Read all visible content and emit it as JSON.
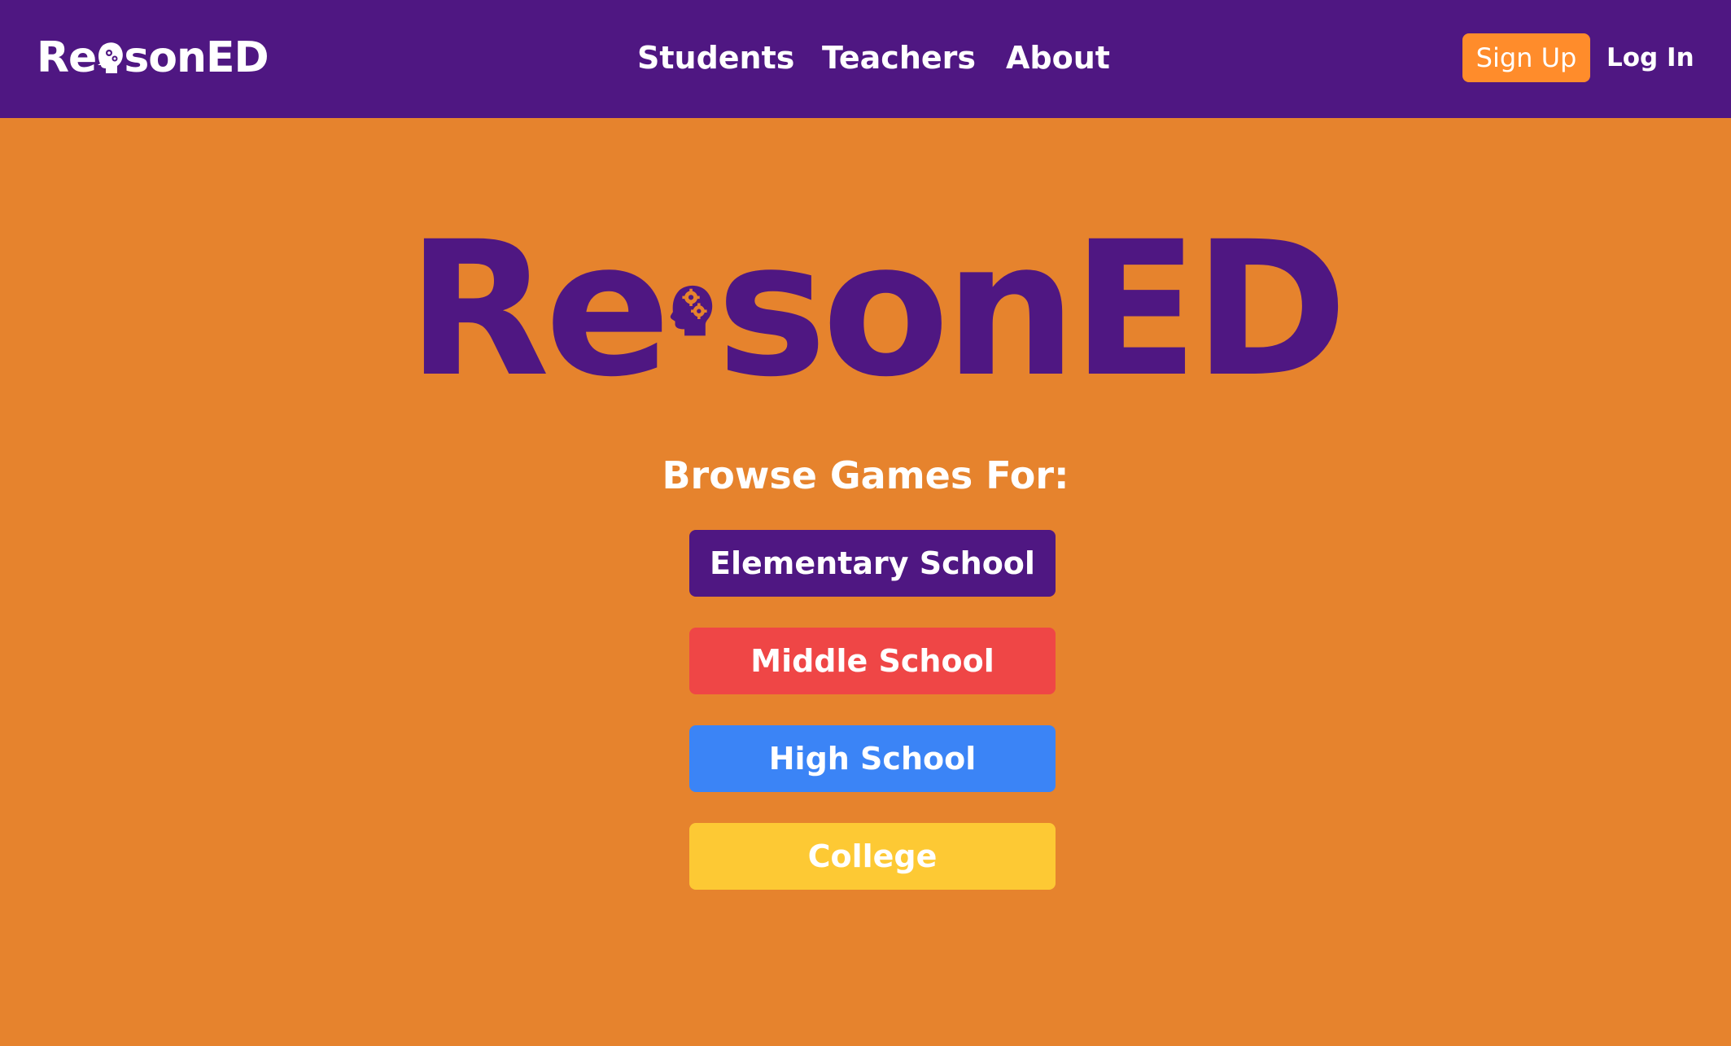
{
  "app": {
    "brand_prefix": "Re",
    "brand_suffix": "sonED",
    "brand_full": "ReasonED"
  },
  "nav": {
    "links": [
      {
        "label": "Students"
      },
      {
        "label": "Teachers"
      },
      {
        "label": "About"
      }
    ],
    "sign_up": "Sign Up",
    "log_in": "Log In"
  },
  "hero": {
    "prompt": "Browse Games For:",
    "levels": [
      {
        "label": "Elementary School",
        "color": "#4F1782"
      },
      {
        "label": "Middle School",
        "color": "#EF4646"
      },
      {
        "label": "High School",
        "color": "#3B84F6"
      },
      {
        "label": "College",
        "color": "#FDC934"
      }
    ]
  },
  "colors": {
    "header_bg": "#4F1782",
    "page_bg": "#E6832D",
    "sign_up_bg": "#FF8C2B",
    "brand_purple": "#4F1782",
    "text_white": "#FFFFFF"
  },
  "icons": {
    "brand_head": "head-gears-icon"
  }
}
